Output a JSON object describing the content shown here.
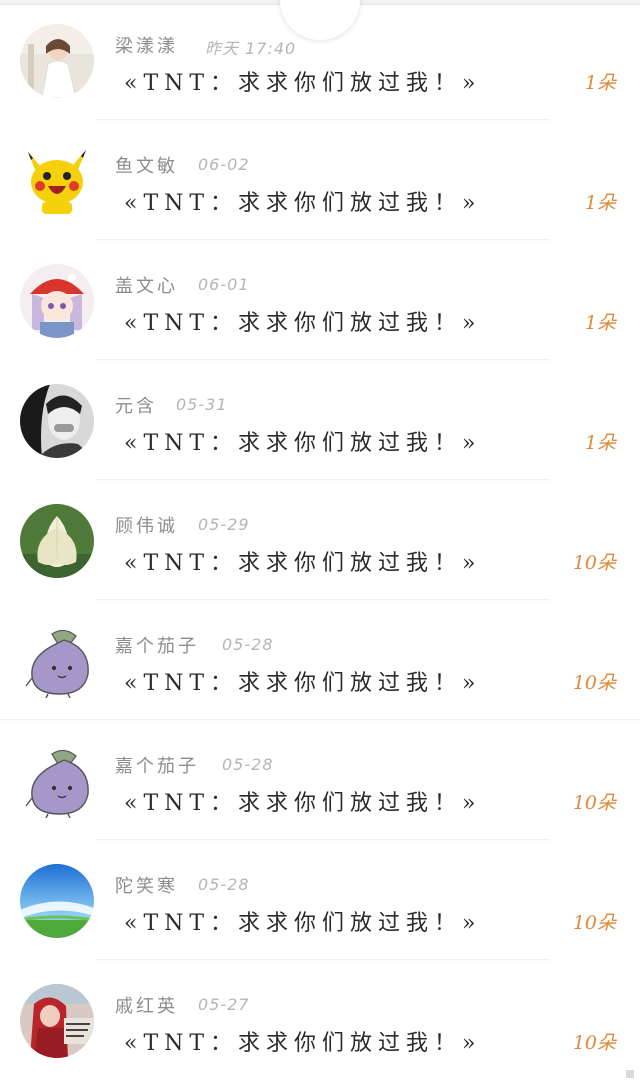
{
  "comments": [
    {
      "name": "梁漾漾",
      "date": "昨天 17:40",
      "message": "«TNT：求求你们放过我！»",
      "count": "1朵",
      "avatar": "girl-white-dress-icon"
    },
    {
      "name": "鱼文敏",
      "date": "06-02",
      "message": "«TNT：求求你们放过我！»",
      "count": "1朵",
      "avatar": "pikachu-icon"
    },
    {
      "name": "盖文心",
      "date": "06-01",
      "message": "«TNT：求求你们放过我！»",
      "count": "1朵",
      "avatar": "anime-girl-red-hat-icon"
    },
    {
      "name": "元含",
      "date": "05-31",
      "message": "«TNT：求求你们放过我！»",
      "count": "1朵",
      "avatar": "bw-girl-photo-icon"
    },
    {
      "name": "顾伟诚",
      "date": "05-29",
      "message": "«TNT：求求你们放过我！»",
      "count": "10朵",
      "avatar": "lotus-flower-icon"
    },
    {
      "name": "嘉个茄子",
      "date": "05-28",
      "message": "«TNT：求求你们放过我！»",
      "count": "10朵",
      "avatar": "eggplant-cartoon-icon"
    },
    {
      "name": "嘉个茄子",
      "date": "05-28",
      "message": "«TNT：求求你们放过我！»",
      "count": "10朵",
      "avatar": "eggplant-cartoon-icon"
    },
    {
      "name": "陀笑寒",
      "date": "05-28",
      "message": "«TNT：求求你们放过我！»",
      "count": "10朵",
      "avatar": "blue-sky-grass-icon"
    },
    {
      "name": "戚红英",
      "date": "05-27",
      "message": "«TNT：求求你们放过我！»",
      "count": "10朵",
      "avatar": "girl-red-hood-icon"
    }
  ],
  "colors": {
    "name": "#8d8d8d",
    "date": "#b5b5b5",
    "message": "#2b2b2b",
    "count": "#e0893c"
  }
}
